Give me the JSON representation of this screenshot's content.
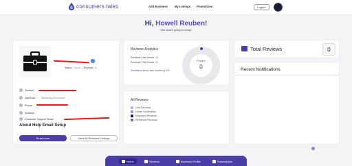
{
  "header": {
    "brand": "consumers tales",
    "nav": [
      "Add Business",
      "My Listings",
      "Promotions"
    ],
    "logout": "Logout"
  },
  "greeting": {
    "hello": "Hi,",
    "user": "Howell Reuben!",
    "subtitle": "See what's going on today!"
  },
  "profile": {
    "status_label": "Status :",
    "status_value": "Owner",
    "reviews_label": "Reviews :",
    "reviews_value": "1",
    "details": [
      {
        "label": "Domain :",
        "value": ""
      },
      {
        "label": "Job/Role :",
        "value": "Marketing Executive"
      },
      {
        "label": "Phone :",
        "value": ""
      },
      {
        "label": "Address :",
        "value": ""
      },
      {
        "label": "Customer Support Email :",
        "value": ""
      }
    ],
    "help_title": "About Help Email Setup",
    "read_more": "Read more",
    "view_all": "View All Business Listings"
  },
  "analytics": {
    "title": "Reviews Analytics",
    "last_month": "Reviews Last Month : 0",
    "this_month": "Reviews This Month : 0",
    "increased": "Increased",
    "increase_text": "since last month by 0%",
    "donut_label": "Percent",
    "donut_value": "0"
  },
  "all_reviews": {
    "title": "All Reviews",
    "legend": [
      {
        "label": "Live Reviews",
        "color": "#b3b8e8"
      },
      {
        "label": "Under Moderation",
        "color": "#8f97dd"
      },
      {
        "label": "Reported Reviews",
        "color": "#1c1d3c"
      },
      {
        "label": "Retrieved Reviews",
        "color": "#7462c9"
      }
    ]
  },
  "total_reviews": {
    "label": "Total Reviews",
    "value": "0"
  },
  "notifications": {
    "title": "Recent Notifications"
  },
  "bottom_nav": [
    "Home",
    "Reviews",
    "Business Profile",
    "Subscription"
  ],
  "colors": {
    "primary": "#4b3fa7",
    "redaction": "#e31b1b"
  }
}
